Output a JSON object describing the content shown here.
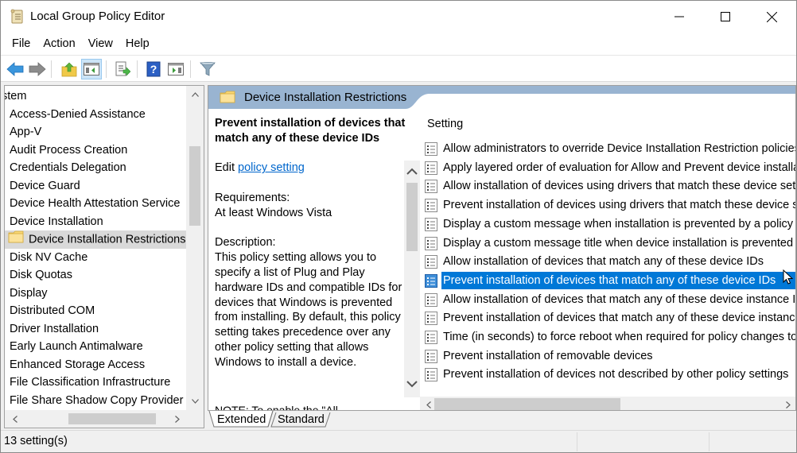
{
  "window": {
    "title": "Local Group Policy Editor",
    "controls": {
      "minimize": "minimize",
      "maximize": "maximize",
      "close": "close"
    }
  },
  "menu": [
    "File",
    "Action",
    "View",
    "Help"
  ],
  "toolbar": {
    "buttons": [
      {
        "name": "back",
        "icon": "back-arrow-icon"
      },
      {
        "name": "forward",
        "icon": "forward-arrow-icon"
      },
      {
        "name": "up-one-level",
        "icon": "folder-up-icon"
      },
      {
        "name": "show-hide-console-tree",
        "icon": "console-tree-icon",
        "active": true
      },
      {
        "name": "export-list",
        "icon": "export-list-icon"
      },
      {
        "name": "help",
        "icon": "help-icon"
      },
      {
        "name": "show-hide-action-pane",
        "icon": "action-pane-icon"
      },
      {
        "name": "filter",
        "icon": "filter-icon"
      }
    ]
  },
  "tree": {
    "items": [
      "stem",
      "Access-Denied Assistance",
      "App-V",
      "Audit Process Creation",
      "Credentials Delegation",
      "Device Guard",
      "Device Health Attestation Service",
      "Device Installation",
      "Device Installation Restrictions",
      "Disk NV Cache",
      "Disk Quotas",
      "Display",
      "Distributed COM",
      "Driver Installation",
      "Early Launch Antimalware",
      "Enhanced Storage Access",
      "File Classification Infrastructure",
      "File Share Shadow Copy Provider"
    ],
    "selected": "Device Installation Restrictions"
  },
  "pane": {
    "header": "Device Installation Restrictions",
    "description": {
      "title": "Prevent installation of devices that match any of these device IDs",
      "edit_prefix": "Edit ",
      "edit_link": "policy setting ",
      "requirements_label": "Requirements:",
      "requirements_value": "At least Windows Vista",
      "description_label": "Description:",
      "description_text": "This policy setting allows you to specify a list of Plug and Play hardware IDs and compatible IDs for devices that Windows is prevented from installing. By default, this policy setting takes precedence over any other policy setting that allows Windows to install a device.",
      "cutoff_text": "NOTE: To enable the \"All"
    },
    "column_header": "Setting",
    "settings": [
      "Allow administrators to override Device Installation Restriction policies",
      "Apply layered order of evaluation for Allow and Prevent device installation policies",
      "Allow installation of devices using drivers that match these device setup classes",
      "Prevent installation of devices using drivers that match these device setup classes",
      "Display a custom message when installation is prevented by a policy setting",
      "Display a custom message title when device installation is prevented by a policy setting",
      "Allow installation of devices that match any of these device IDs",
      "Prevent installation of devices that match any of these device IDs",
      "Allow installation of devices that match any of these device instance IDs",
      "Prevent installation of devices that match any of these device instance IDs",
      "Time (in seconds) to force reboot when required for policy changes to take effect",
      "Prevent installation of removable devices",
      "Prevent installation of devices not described by other policy settings"
    ],
    "selected_index": 7,
    "tabs": [
      "Extended",
      "Standard"
    ],
    "active_tab": "Extended"
  },
  "status": {
    "text": "13 setting(s)"
  },
  "colors": {
    "selection": "#0078d7",
    "pane_header": "#99b4d1",
    "link": "#0066cc",
    "tree_selected": "#d9d9d9"
  }
}
